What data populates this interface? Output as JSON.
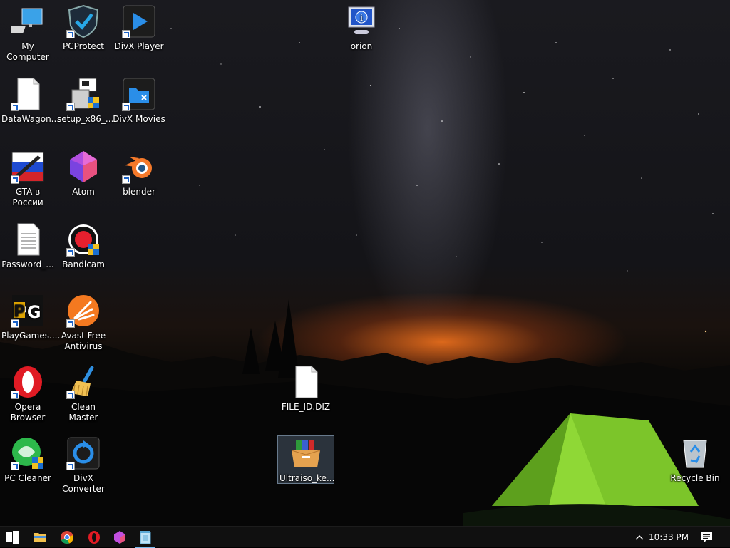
{
  "desktop": {
    "icons": [
      {
        "label": "My Computer",
        "icon": "computer-icon",
        "shortcut": false
      },
      {
        "label": "PCProtect",
        "icon": "shield-icon",
        "shortcut": true
      },
      {
        "label": "DivX Player",
        "icon": "play-icon",
        "shortcut": true
      },
      {
        "label": "orion",
        "icon": "info-monitor-icon",
        "shortcut": false
      },
      {
        "label": "DataWagon...",
        "icon": "blank-file-icon",
        "shortcut": true
      },
      {
        "label": "setup_x86_...",
        "icon": "installer-icon",
        "shortcut": true
      },
      {
        "label": "DivX Movies",
        "icon": "movies-folder-icon",
        "shortcut": true
      },
      {
        "label": "GTA в России",
        "icon": "gta-icon",
        "shortcut": true
      },
      {
        "label": "Atom",
        "icon": "atom-icon",
        "shortcut": false
      },
      {
        "label": "blender",
        "icon": "blender-icon",
        "shortcut": true
      },
      {
        "label": "Password_...",
        "icon": "text-file-icon",
        "shortcut": false
      },
      {
        "label": "Bandicam",
        "icon": "bandicam-icon",
        "shortcut": true
      },
      {
        "label": "PlayGames....",
        "icon": "pg-icon",
        "shortcut": true
      },
      {
        "label": "Avast Free Antivirus",
        "icon": "avast-icon",
        "shortcut": true
      },
      {
        "label": "Opera Browser",
        "icon": "opera-icon",
        "shortcut": true
      },
      {
        "label": "Clean Master",
        "icon": "broom-icon",
        "shortcut": true
      },
      {
        "label": "FILE_ID.DIZ",
        "icon": "blank-file-icon",
        "shortcut": false
      },
      {
        "label": "Ultraiso_ke...",
        "icon": "archive-box-icon",
        "shortcut": false,
        "selected": true
      },
      {
        "label": "PC Cleaner",
        "icon": "pc-cleaner-icon",
        "shortcut": true
      },
      {
        "label": "DivX Converter",
        "icon": "divx-converter-icon",
        "shortcut": true
      },
      {
        "label": "Recycle Bin",
        "icon": "recycle-bin-icon",
        "shortcut": false
      }
    ]
  },
  "taskbar": {
    "items": [
      {
        "name": "start-button",
        "icon": "windows-logo-icon"
      },
      {
        "name": "file-explorer",
        "icon": "folder-icon"
      },
      {
        "name": "chrome",
        "icon": "chrome-icon"
      },
      {
        "name": "opera",
        "icon": "opera-icon"
      },
      {
        "name": "atom",
        "icon": "atom-icon"
      },
      {
        "name": "notepad",
        "icon": "notepad-icon",
        "active": true
      }
    ],
    "tray": {
      "chevron_icon": "chevron-up-icon",
      "time": "10:33 PM",
      "notification_icon": "action-center-icon"
    }
  },
  "colors": {
    "taskbar_bg": "#101010",
    "active_indicator": "#76b9ed",
    "shortcut_arrow": "#1c63c8"
  }
}
